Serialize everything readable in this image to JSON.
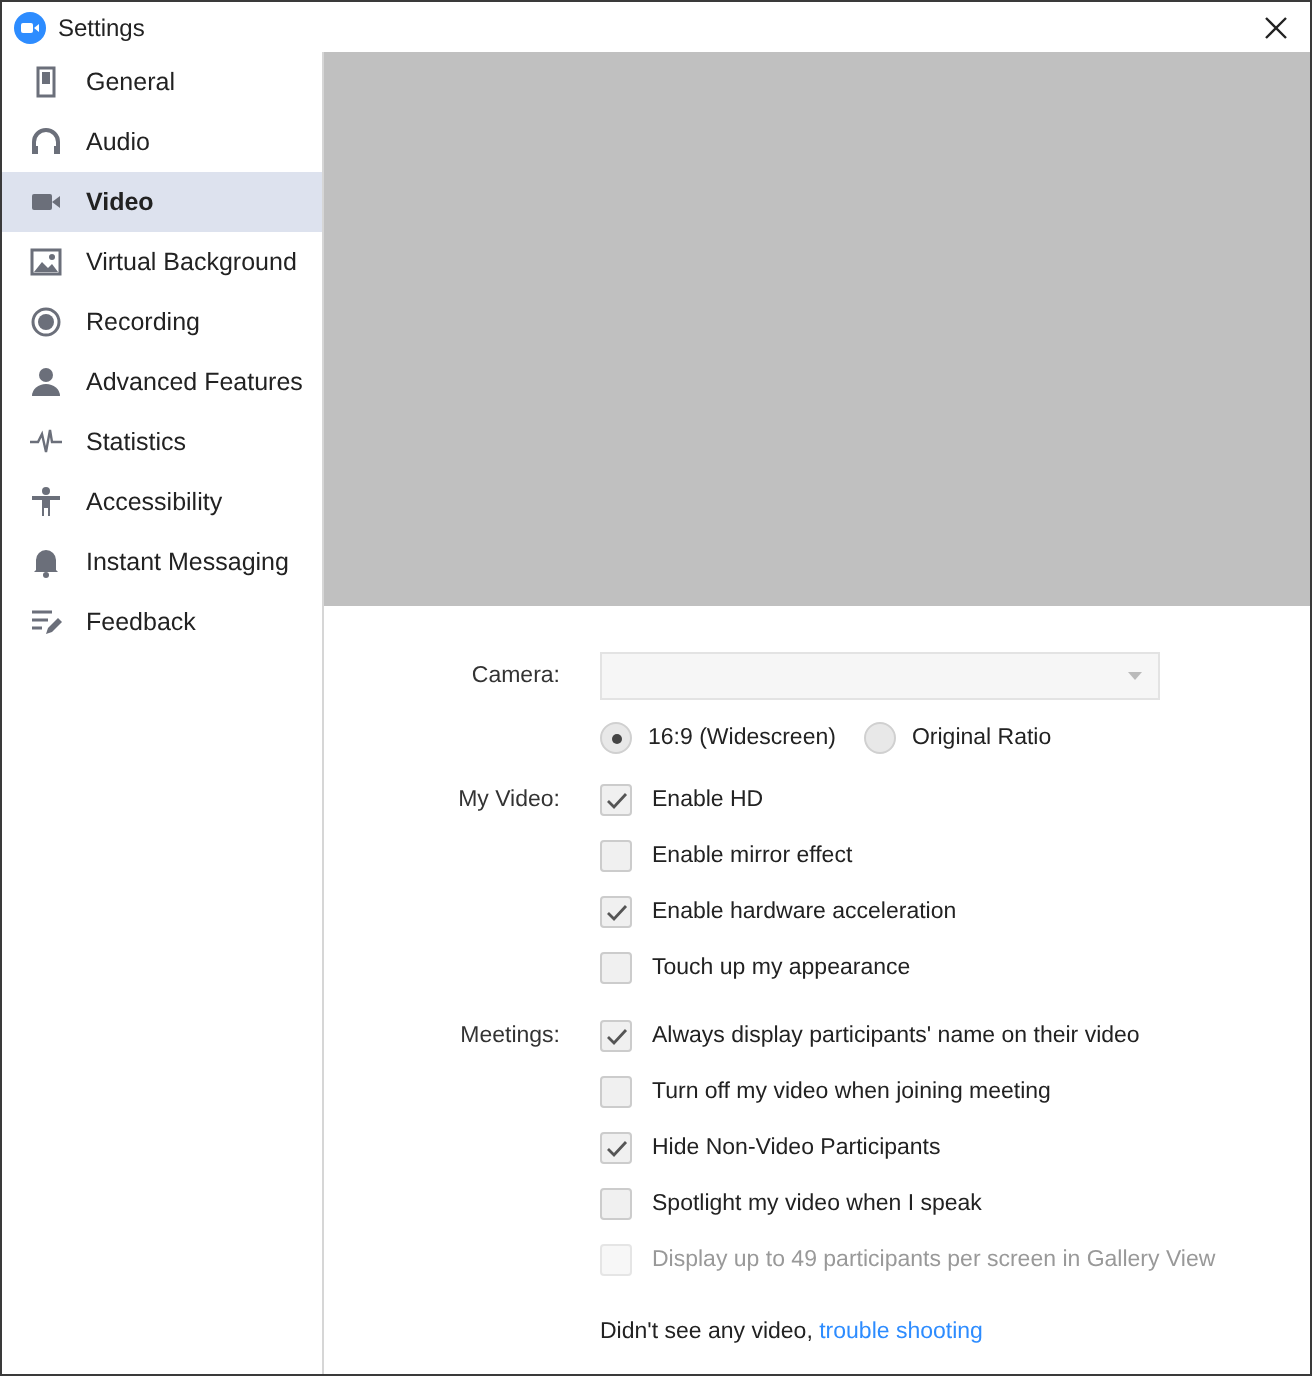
{
  "window": {
    "title": "Settings"
  },
  "sidebar": {
    "items": [
      {
        "label": "General",
        "selected": false
      },
      {
        "label": "Audio",
        "selected": false
      },
      {
        "label": "Video",
        "selected": true
      },
      {
        "label": "Virtual Background",
        "selected": false
      },
      {
        "label": "Recording",
        "selected": false
      },
      {
        "label": "Advanced Features",
        "selected": false
      },
      {
        "label": "Statistics",
        "selected": false
      },
      {
        "label": "Accessibility",
        "selected": false
      },
      {
        "label": "Instant Messaging",
        "selected": false
      },
      {
        "label": "Feedback",
        "selected": false
      }
    ]
  },
  "camera": {
    "label": "Camera:",
    "disabled": true,
    "ratios": [
      {
        "label": "16:9 (Widescreen)",
        "selected": true
      },
      {
        "label": "Original Ratio",
        "selected": false
      }
    ]
  },
  "sections": [
    {
      "label": "My Video:",
      "options": [
        {
          "label": "Enable HD",
          "checked": true,
          "disabled": false
        },
        {
          "label": "Enable mirror effect",
          "checked": false,
          "disabled": false
        },
        {
          "label": "Enable hardware acceleration",
          "checked": true,
          "disabled": false
        },
        {
          "label": "Touch up my appearance",
          "checked": false,
          "disabled": false
        }
      ]
    },
    {
      "label": "Meetings:",
      "options": [
        {
          "label": "Always display participants' name on their video",
          "checked": true,
          "disabled": false
        },
        {
          "label": "Turn off my video when joining meeting",
          "checked": false,
          "disabled": false
        },
        {
          "label": "Hide Non-Video Participants",
          "checked": true,
          "disabled": false
        },
        {
          "label": "Spotlight my video when I speak",
          "checked": false,
          "disabled": false
        },
        {
          "label": "Display up to 49 participants per screen in Gallery View",
          "checked": false,
          "disabled": true
        }
      ]
    }
  ],
  "footer": {
    "text": "Didn't see any video,",
    "link": "trouble shooting"
  }
}
